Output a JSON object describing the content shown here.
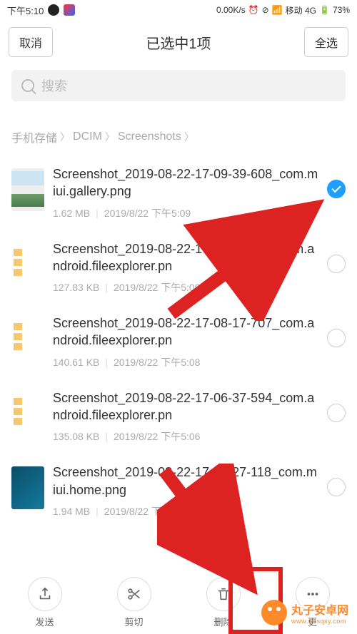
{
  "status_bar": {
    "time": "下午5:10",
    "net_speed": "0.00K/s",
    "carrier": "移动 4G",
    "battery": "73%"
  },
  "header": {
    "cancel": "取消",
    "title": "已选中1项",
    "select_all": "全选"
  },
  "search": {
    "placeholder": "搜索"
  },
  "breadcrumb": {
    "parts": [
      "手机存储",
      "DCIM",
      "Screenshots"
    ]
  },
  "files": [
    {
      "name": "Screenshot_2019-08-22-17-09-39-608_com.miui.gallery.png",
      "size": "1.62 MB",
      "date": "2019/8/22 下午5:09",
      "thumb": "landscape",
      "selected": true
    },
    {
      "name": "Screenshot_2019-08-22-17-08-22-421_com.android.fileexplorer.pn",
      "size": "127.83 KB",
      "date": "2019/8/22 下午5:08",
      "thumb": "files",
      "selected": false
    },
    {
      "name": "Screenshot_2019-08-22-17-08-17-707_com.android.fileexplorer.pn",
      "size": "140.61 KB",
      "date": "2019/8/22 下午5:08",
      "thumb": "files",
      "selected": false
    },
    {
      "name": "Screenshot_2019-08-22-17-06-37-594_com.android.fileexplorer.pn",
      "size": "135.08 KB",
      "date": "2019/8/22 下午5:06",
      "thumb": "files",
      "selected": false
    },
    {
      "name": "Screenshot_2019-08-22-17-06-27-118_com.miui.home.png",
      "size": "1.94 MB",
      "date": "2019/8/22 下午5:06",
      "thumb": "home",
      "selected": false
    }
  ],
  "actions": {
    "send": "发送",
    "cut": "剪切",
    "delete": "删除",
    "more": "更"
  },
  "watermark": {
    "main": "丸子安卓网",
    "sub": "www.wzsqsy.com"
  }
}
